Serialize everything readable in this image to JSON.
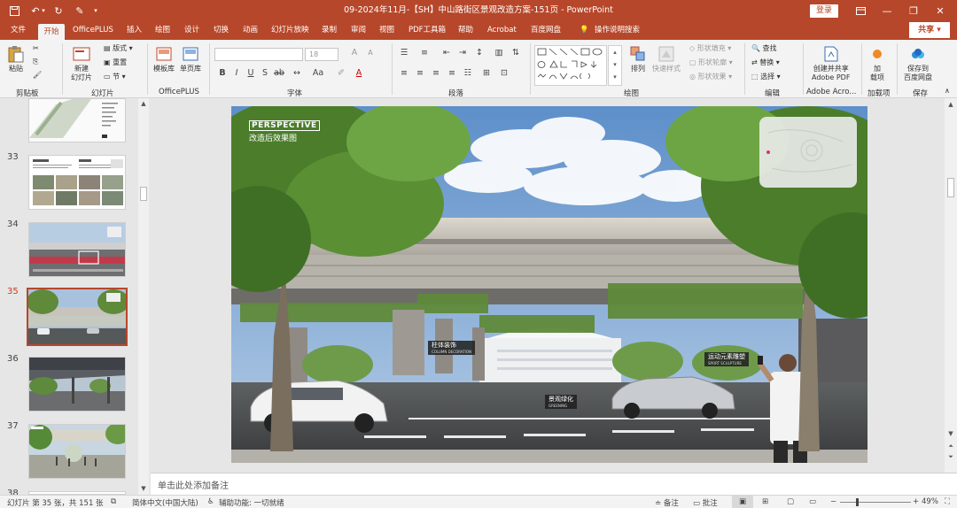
{
  "titlebar": {
    "title": "09-2024年11月-【SH】中山路街区景观改造方案-151页 - PowerPoint",
    "login": "登录"
  },
  "menu": {
    "tabs": [
      "文件",
      "开始",
      "OfficePLUS",
      "插入",
      "绘图",
      "设计",
      "切换",
      "动画",
      "幻灯片放映",
      "录制",
      "审阅",
      "视图",
      "PDF工具箱",
      "帮助",
      "Acrobat",
      "百度网盘"
    ],
    "active": "开始",
    "search": "操作说明搜索",
    "share": "共享"
  },
  "ribbon": {
    "clipboard": {
      "paste": "粘贴",
      "label": "剪贴板"
    },
    "slides": {
      "new_slide_1": "新建",
      "new_slide_2": "幻灯片",
      "layout": "版式",
      "reset": "重置",
      "section": "节",
      "label": "幻灯片"
    },
    "officeplus": {
      "template": "模板库",
      "single": "单页库",
      "label": "OfficePLUS"
    },
    "font": {
      "size": "18",
      "label": "字体"
    },
    "paragraph": {
      "label": "段落"
    },
    "drawing": {
      "arrange": "排列",
      "quick_style": "快速样式",
      "fill": "形状填充",
      "outline": "形状轮廓",
      "effect": "形状效果",
      "label": "绘图"
    },
    "editing": {
      "find": "查找",
      "replace": "替换",
      "select": "选择",
      "label": "编辑"
    },
    "adobe": {
      "line1": "创建并共享",
      "line2": "Adobe PDF",
      "label": "Adobe Acro..."
    },
    "addins": {
      "line1": "加",
      "line2": "载项",
      "label": "加载项"
    },
    "save": {
      "line1": "保存到",
      "line2": "百度网盘",
      "label": "保存"
    }
  },
  "thumbnails": [
    {
      "num": "33"
    },
    {
      "num": "34"
    },
    {
      "num": "35",
      "active": true
    },
    {
      "num": "36"
    },
    {
      "num": "37"
    },
    {
      "num": "38"
    }
  ],
  "slide": {
    "heading_en": "PERSPECTIVE",
    "heading_cn": "改造后效果图",
    "tag_column": {
      "cn": "柱体装饰",
      "en": "COLUMN DECORATION"
    },
    "tag_sport": {
      "cn": "运动元素雕塑",
      "en": "SPORT SCULPTURE"
    },
    "tag_green": {
      "cn": "景观绿化",
      "en": "GREENING"
    }
  },
  "notes": {
    "placeholder": "单击此处添加备注"
  },
  "status": {
    "slide_info": "幻灯片 第 35 张，共 151 张",
    "language": "简体中文(中国大陆)",
    "accessibility": "辅助功能: 一切就绪",
    "notes_btn": "备注",
    "comments_btn": "批注",
    "zoom": "49%"
  },
  "colors": {
    "accent": "#b7472a",
    "active_slide_num": "#c43e1c"
  }
}
